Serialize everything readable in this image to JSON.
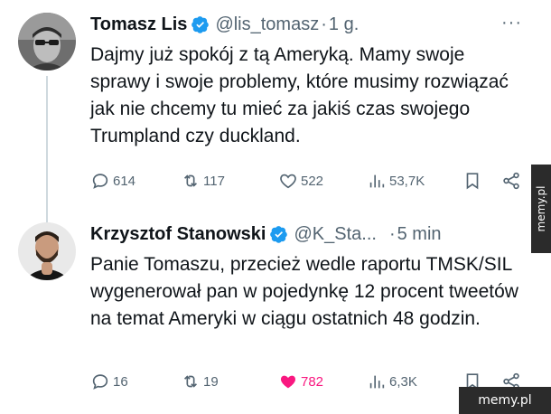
{
  "tweets": [
    {
      "author_name": "Tomasz Lis",
      "handle": "@lis_tomasz",
      "separator": "·",
      "time": "1 g.",
      "more": "···",
      "text": "Dajmy już spokój z tą Ameryką. Mamy swoje sprawy i swoje problemy, które musimy rozwiązać jak nie chcemy tu mieć za jakiś czas swojego Trumpland czy duckland.",
      "stats": {
        "replies": "614",
        "retweets": "117",
        "likes": "522",
        "views": "53,7K"
      },
      "liked": false,
      "avatar_icon": "user-avatar-sunglasses"
    },
    {
      "author_name": "Krzysztof Stanowski",
      "handle": "@K_Sta...",
      "separator": "·",
      "time": "5 min",
      "text": "Panie Tomaszu, przecież wedle raportu TMSK/SIL wygenerował pan w pojedynkę 12 procent tweetów na temat Ameryki w ciągu ostatnich 48 godzin.",
      "stats": {
        "replies": "16",
        "retweets": "19",
        "likes": "782",
        "views": "6,3K"
      },
      "liked": true,
      "avatar_icon": "user-avatar-beard"
    }
  ],
  "watermark": {
    "side": "memy.pl",
    "corner": "memy.pl"
  },
  "colors": {
    "verified": "#1d9bf0",
    "like_active": "#f91880",
    "muted": "#536471",
    "text": "#0f1419"
  }
}
